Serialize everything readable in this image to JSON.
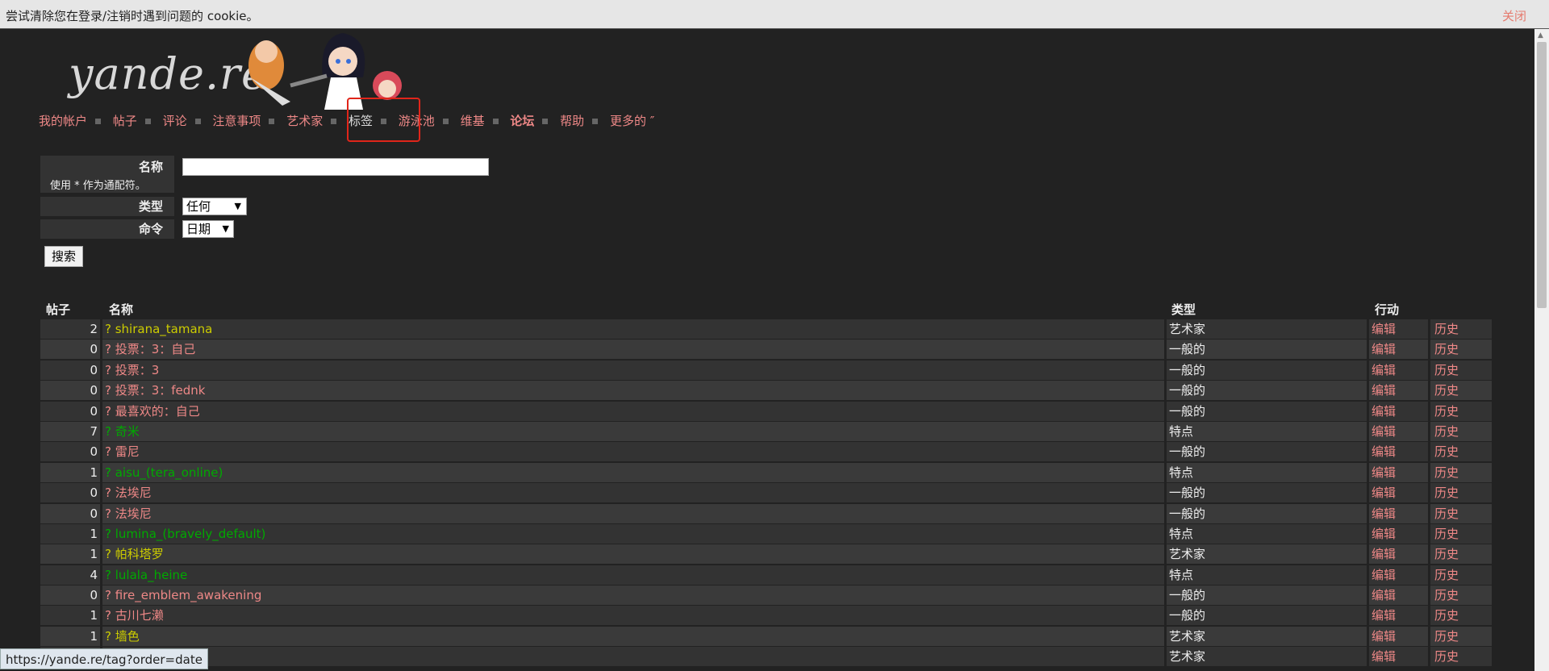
{
  "notice": {
    "message": "尝试清除您在登录/注销时遇到问题的 cookie。",
    "close_label": "关闭"
  },
  "site": {
    "logo_text": "yande.re"
  },
  "nav": {
    "items": [
      {
        "label": "我的帐户",
        "bold": false
      },
      {
        "label": "帖子",
        "bold": false
      },
      {
        "label": "评论",
        "bold": false
      },
      {
        "label": "注意事项",
        "bold": false
      },
      {
        "label": "艺术家",
        "bold": false
      },
      {
        "label": "标签",
        "bold": false,
        "current": true
      },
      {
        "label": "游泳池",
        "bold": false
      },
      {
        "label": "维基",
        "bold": false
      },
      {
        "label": "论坛",
        "bold": true
      },
      {
        "label": "帮助",
        "bold": false
      },
      {
        "label": "更多的 ″",
        "bold": false
      }
    ]
  },
  "search": {
    "name_label": "名称",
    "name_hint": "使用 * 作为通配符。",
    "name_value": "",
    "type_label": "类型",
    "type_value": "任何",
    "order_label": "命令",
    "order_value": "日期",
    "submit_label": "搜索"
  },
  "table": {
    "headers": {
      "count": "帖子",
      "name": "名称",
      "type": "类型",
      "actions": "行动"
    },
    "edit_label": "编辑",
    "history_label": "历史",
    "rows": [
      {
        "count": "2",
        "name": "? shirana_tamana",
        "type": "艺术家",
        "kind": "artist"
      },
      {
        "count": "0",
        "name": "? 投票：3：自己",
        "type": "一般的",
        "kind": "general"
      },
      {
        "count": "0",
        "name": "? 投票：3",
        "type": "一般的",
        "kind": "general"
      },
      {
        "count": "0",
        "name": "? 投票：3：fednk",
        "type": "一般的",
        "kind": "general"
      },
      {
        "count": "0",
        "name": "? 最喜欢的：自己",
        "type": "一般的",
        "kind": "general"
      },
      {
        "count": "7",
        "name": "? 奇米",
        "type": "特点",
        "kind": "character"
      },
      {
        "count": "0",
        "name": "? 雷尼",
        "type": "一般的",
        "kind": "general"
      },
      {
        "count": "1",
        "name": "? aisu_(tera_online)",
        "type": "特点",
        "kind": "character"
      },
      {
        "count": "0",
        "name": "? 法埃尼",
        "type": "一般的",
        "kind": "general"
      },
      {
        "count": "0",
        "name": "? 法埃尼",
        "type": "一般的",
        "kind": "general"
      },
      {
        "count": "1",
        "name": "? lumina_(bravely_default)",
        "type": "特点",
        "kind": "character"
      },
      {
        "count": "1",
        "name": "? 帕科塔罗",
        "type": "艺术家",
        "kind": "artist"
      },
      {
        "count": "4",
        "name": "? lulala_heine",
        "type": "特点",
        "kind": "character"
      },
      {
        "count": "0",
        "name": "? fire_emblem_awakening",
        "type": "一般的",
        "kind": "general"
      },
      {
        "count": "1",
        "name": "? 古川七濑",
        "type": "一般的",
        "kind": "general"
      },
      {
        "count": "1",
        "name": "? 墙色",
        "type": "艺术家",
        "kind": "artist"
      },
      {
        "count": "",
        "name": "",
        "type": "艺术家",
        "kind": "artist"
      }
    ]
  },
  "status_bar": {
    "url": "https://yande.re/tag?order=date"
  },
  "colors": {
    "artist": "#cccc00",
    "general": "#ee8887",
    "character": "#00aa00",
    "background": "#222222",
    "highlight_box": "#e0251a"
  }
}
